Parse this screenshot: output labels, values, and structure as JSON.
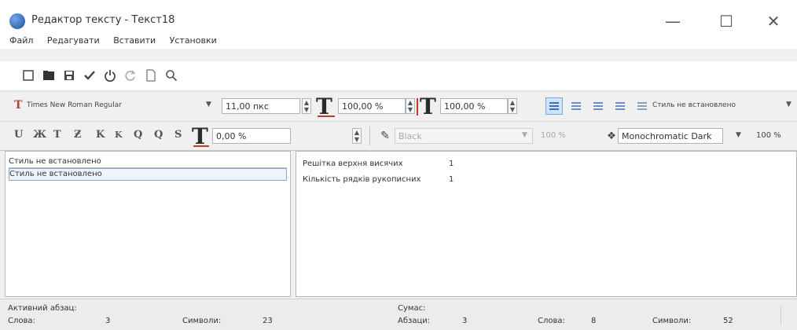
{
  "window": {
    "title": "Редактор тексту - Текст18",
    "minimize": "—",
    "maximize": "☐",
    "close": "✕"
  },
  "menu": [
    "Файл",
    "Редагувати",
    "Вставити",
    "Установки"
  ],
  "toolbar1": {
    "icons": [
      "new-document-icon",
      "open-folder-icon",
      "save-icon",
      "checkmark-icon",
      "power-icon",
      "redo-icon",
      "blank-page-icon",
      "search-icon"
    ]
  },
  "toolbar2": {
    "font_icon_text": "T",
    "font_name": "Times New Roman Regular",
    "font_size": "11,00 пкс",
    "scale_h": "100,00 %",
    "scale_v": "100,00 %",
    "style_label": "Стиль не встановлено"
  },
  "toolbar3": {
    "buttons": [
      "U",
      "Ж",
      "T",
      "Ƶ",
      "K",
      "K",
      "Q",
      "Q",
      "S"
    ],
    "spacing_value": "0,00 %",
    "color_name": "Black",
    "opacity": "100 %",
    "theme": "Monochromatic Dark",
    "theme_opacity": "100 %"
  },
  "styles_list": [
    "Стиль не встановлено",
    "Стиль не встановлено"
  ],
  "document_info": [
    {
      "label": "Решітка верхня висячих",
      "value": "1"
    },
    {
      "label": "Кількість рядків рукописних",
      "value": "1"
    }
  ],
  "status": {
    "active_paragraph": "Активний абзац:",
    "total": "Сумас:",
    "words_label": "Слова:",
    "words_value": "3",
    "chars_label": "Символи:",
    "chars_value": "23",
    "paragraphs_label": "Абзаци:",
    "paragraphs_value": "3",
    "total_words_label": "Слова:",
    "total_words_value": "8",
    "total_chars_label": "Символи:",
    "total_chars_value": "52"
  },
  "colors": {
    "accent": "#3d6fb8",
    "panel_bg": "#ffffff",
    "chrome_bg": "#f0f0f0"
  }
}
